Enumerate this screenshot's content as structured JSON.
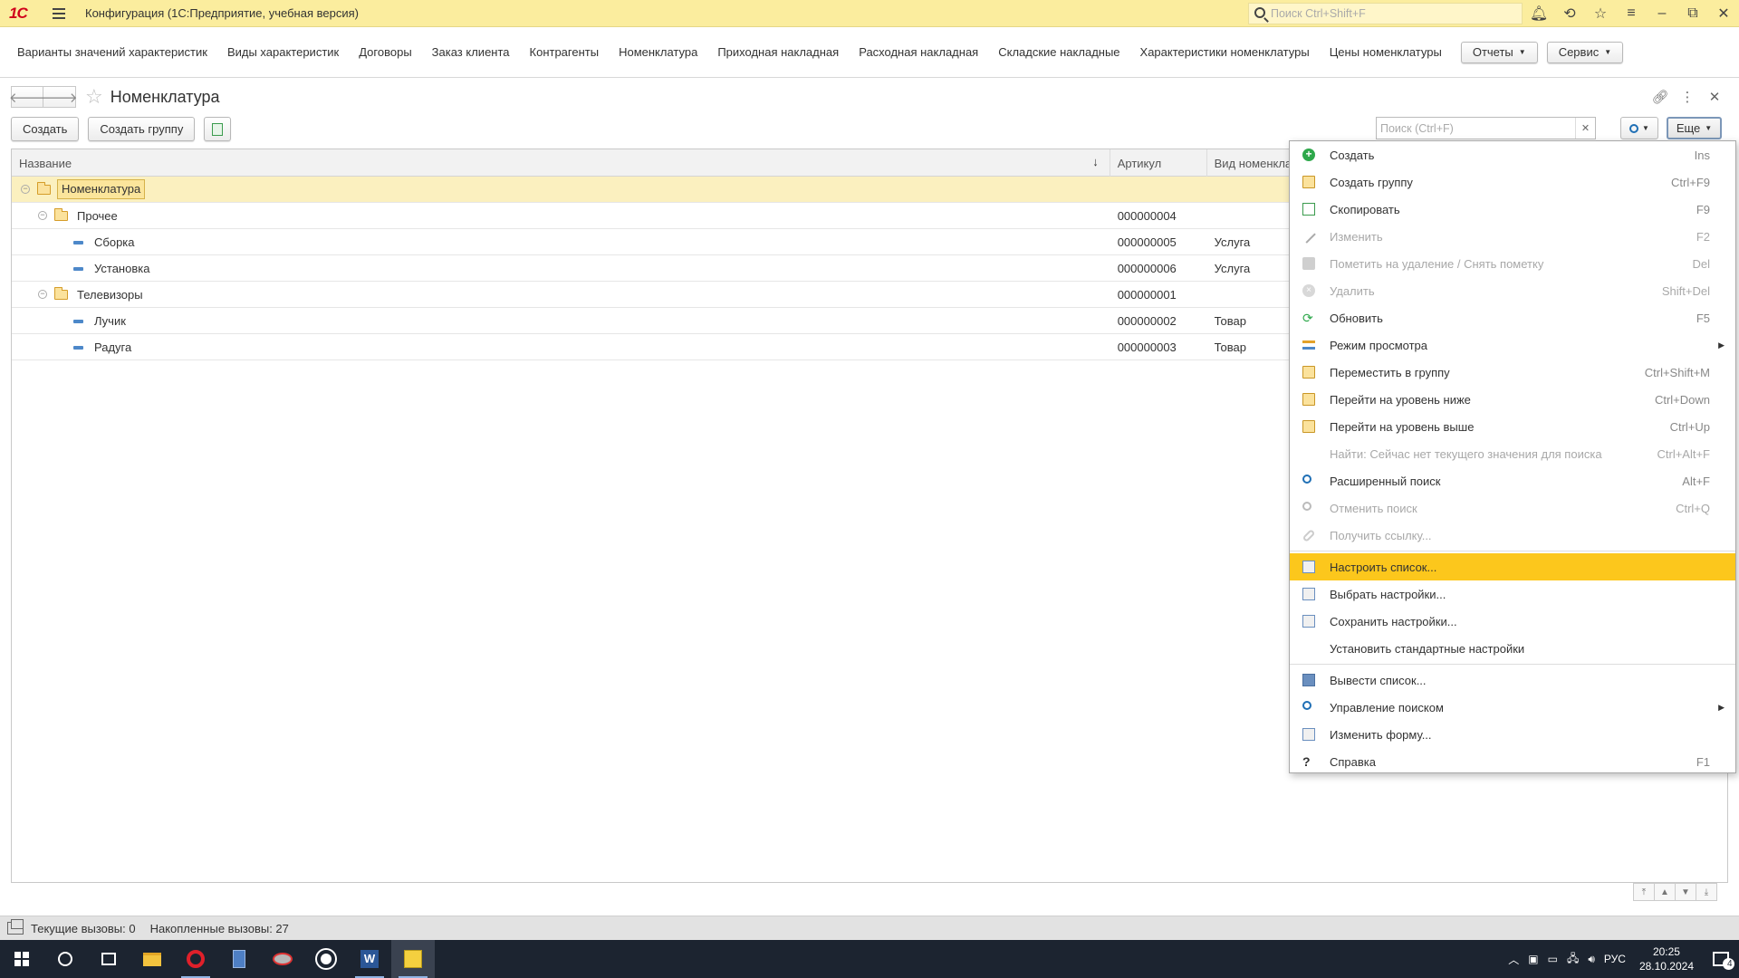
{
  "titlebar": {
    "logo": "1С",
    "title": "Конфигурация  (1С:Предприятие, учебная версия)",
    "search_placeholder": "Поиск Ctrl+Shift+F"
  },
  "sections": {
    "items": [
      "Варианты значений характеристик",
      "Виды характеристик",
      "Договоры",
      "Заказ клиента",
      "Контрагенты",
      "Номенклатура",
      "Приходная накладная",
      "Расходная накладная",
      "Складские накладные",
      "Характеристики номенклатуры",
      "Цены номенклатуры"
    ],
    "reports_label": "Отчеты",
    "service_label": "Сервис"
  },
  "form": {
    "title": "Номенклатура",
    "create_label": "Создать",
    "create_group_label": "Создать группу",
    "search_placeholder": "Поиск (Ctrl+F)",
    "more_label": "Еще"
  },
  "table": {
    "columns": [
      "Название",
      "Артикул",
      "Вид номенкла"
    ],
    "rows": [
      {
        "name": "Номенклатура",
        "article": "",
        "kind": "",
        "level": 0,
        "type": "folder",
        "selected": true
      },
      {
        "name": "Прочее",
        "article": "000000004",
        "kind": "",
        "level": 1,
        "type": "folder"
      },
      {
        "name": "Сборка",
        "article": "000000005",
        "kind": "Услуга",
        "level": 2,
        "type": "item"
      },
      {
        "name": "Установка",
        "article": "000000006",
        "kind": "Услуга",
        "level": 2,
        "type": "item"
      },
      {
        "name": "Телевизоры",
        "article": "000000001",
        "kind": "",
        "level": 1,
        "type": "folder"
      },
      {
        "name": "Лучик",
        "article": "000000002",
        "kind": "Товар",
        "level": 2,
        "type": "item"
      },
      {
        "name": "Радуга",
        "article": "000000003",
        "kind": "Товар",
        "level": 2,
        "type": "item"
      }
    ]
  },
  "menu": {
    "items": [
      {
        "label": "Создать",
        "shortcut": "Ins",
        "icon": "plus-circle-icon"
      },
      {
        "label": "Создать группу",
        "shortcut": "Ctrl+F9",
        "icon": "folder-add-icon"
      },
      {
        "label": "Скопировать",
        "shortcut": "F9",
        "icon": "copy-icon"
      },
      {
        "label": "Изменить",
        "shortcut": "F2",
        "icon": "pencil-icon",
        "disabled": true
      },
      {
        "label": "Пометить на удаление / Снять пометку",
        "shortcut": "Del",
        "icon": "mark-delete-icon",
        "disabled": true
      },
      {
        "label": "Удалить",
        "shortcut": "Shift+Del",
        "icon": "delete-icon",
        "disabled": true
      },
      {
        "label": "Обновить",
        "shortcut": "F5",
        "icon": "refresh-icon"
      },
      {
        "label": "Режим просмотра",
        "shortcut": "",
        "icon": "view-mode-icon",
        "submenu": true
      },
      {
        "label": "Переместить в группу",
        "shortcut": "Ctrl+Shift+M",
        "icon": "move-to-group-icon"
      },
      {
        "label": "Перейти на уровень ниже",
        "shortcut": "Ctrl+Down",
        "icon": "level-down-icon"
      },
      {
        "label": "Перейти на уровень выше",
        "shortcut": "Ctrl+Up",
        "icon": "level-up-icon"
      },
      {
        "label": "Найти: Сейчас нет текущего значения для поиска",
        "shortcut": "Ctrl+Alt+F",
        "icon": "",
        "disabled": true
      },
      {
        "label": "Расширенный поиск",
        "shortcut": "Alt+F",
        "icon": "search-icon"
      },
      {
        "label": "Отменить поиск",
        "shortcut": "Ctrl+Q",
        "icon": "cancel-search-icon",
        "disabled": true
      },
      {
        "label": "Получить ссылку...",
        "shortcut": "",
        "icon": "link-icon",
        "disabled": true
      },
      {
        "separator": true
      },
      {
        "label": "Настроить список...",
        "shortcut": "",
        "icon": "list-settings-icon",
        "highlight": true
      },
      {
        "label": "Выбрать настройки...",
        "shortcut": "",
        "icon": "select-settings-icon"
      },
      {
        "label": "Сохранить настройки...",
        "shortcut": "",
        "icon": "save-settings-icon"
      },
      {
        "label": "Установить стандартные настройки",
        "shortcut": "",
        "icon": ""
      },
      {
        "separator": true
      },
      {
        "label": "Вывести список...",
        "shortcut": "",
        "icon": "print-list-icon"
      },
      {
        "label": "Управление поиском",
        "shortcut": "",
        "icon": "search-manage-icon",
        "submenu": true
      },
      {
        "label": "Изменить форму...",
        "shortcut": "",
        "icon": "edit-form-icon"
      },
      {
        "label": "Справка",
        "shortcut": "F1",
        "icon": "help-icon"
      }
    ]
  },
  "status": {
    "current_calls": "Текущие вызовы: 0",
    "accumulated_calls": "Накопленные вызовы: 27"
  },
  "taskbar": {
    "lang": "РУС",
    "time": "20:25",
    "date": "28.10.2024",
    "notifications": "4"
  }
}
